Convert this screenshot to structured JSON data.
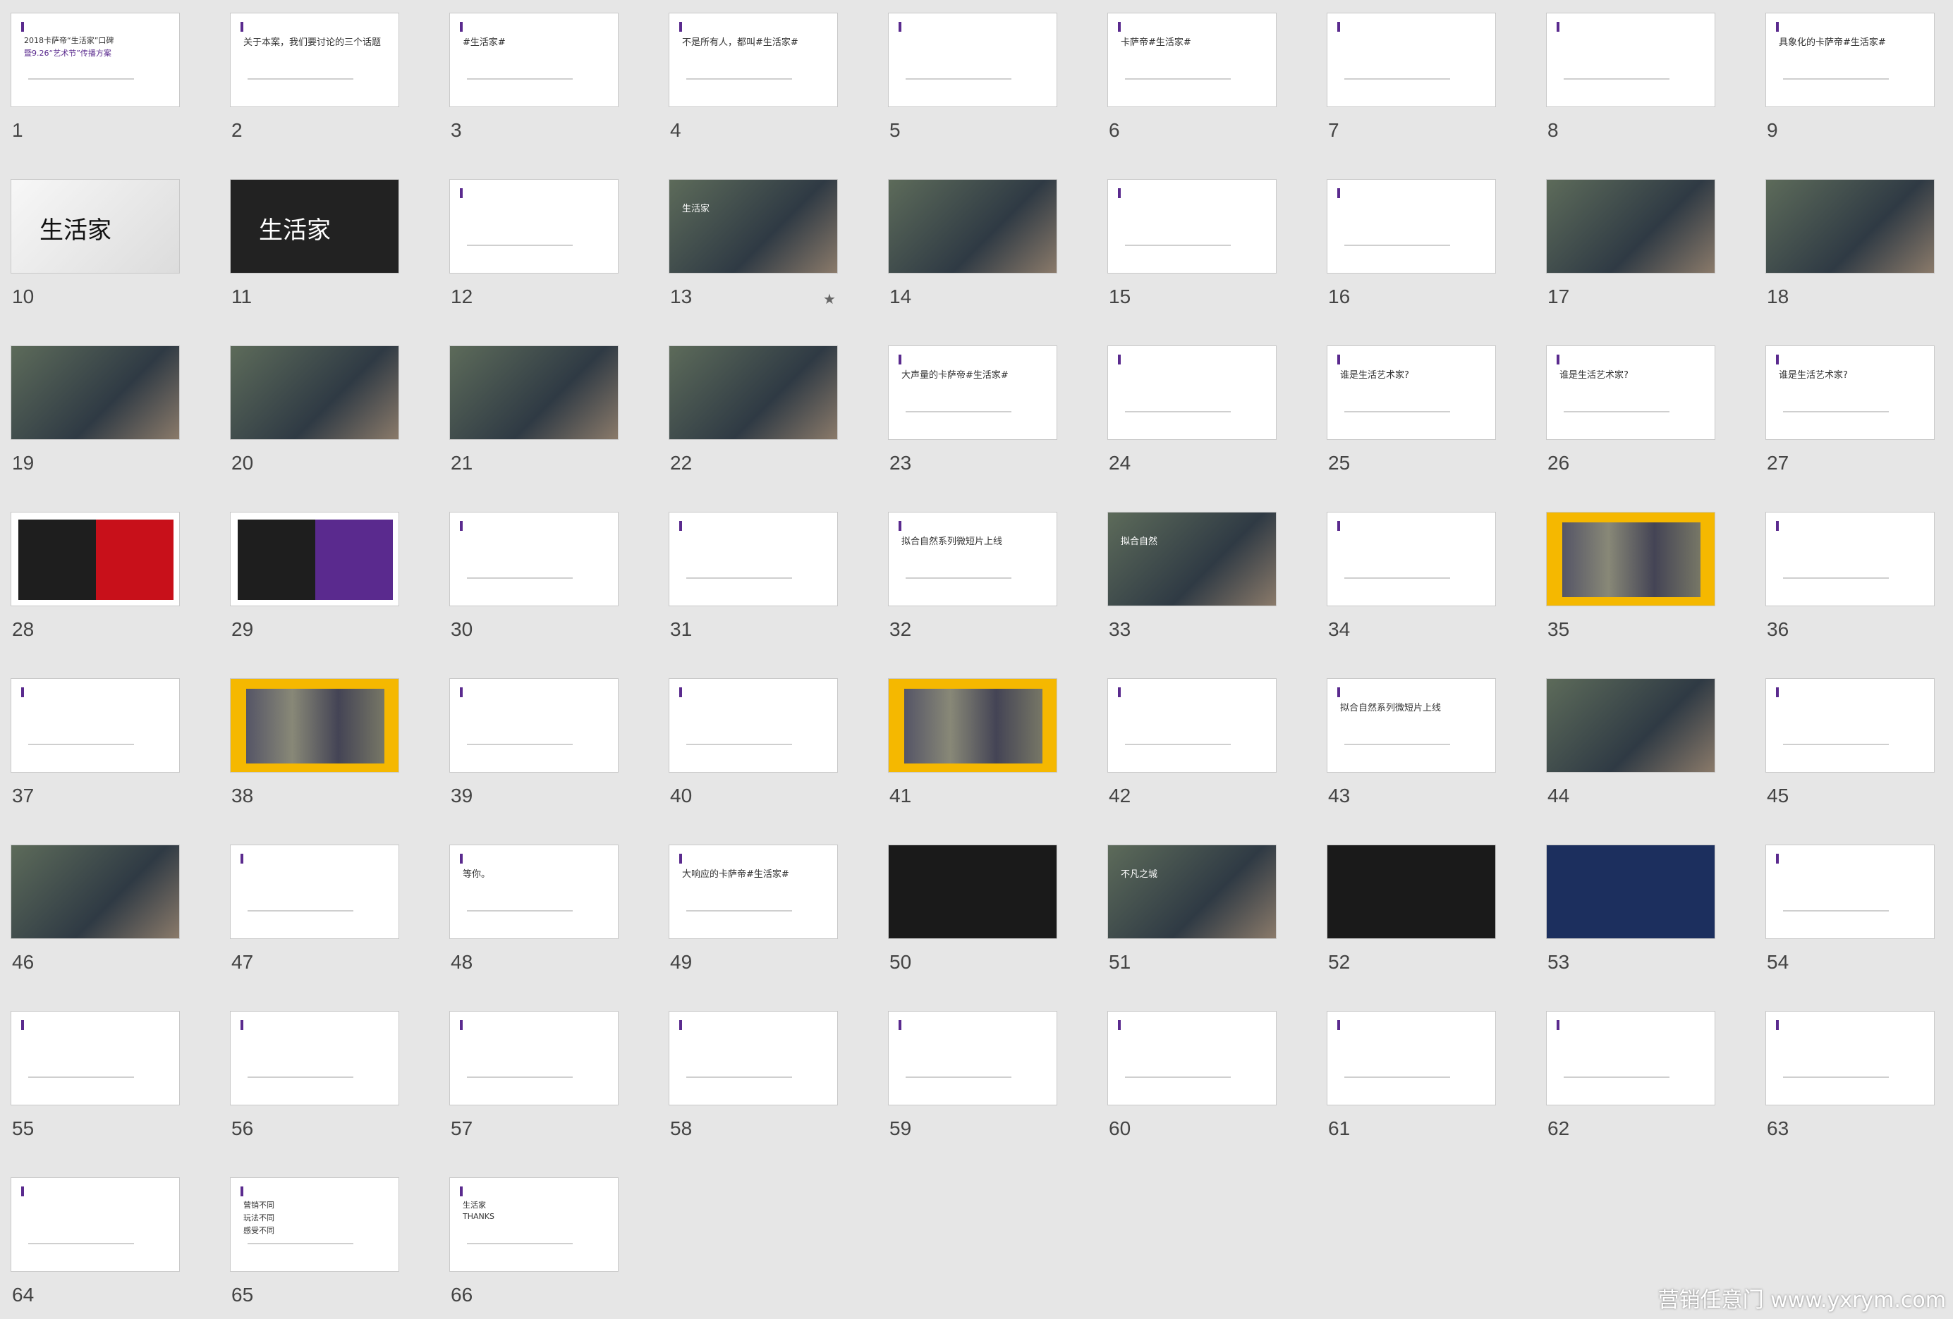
{
  "app": {
    "view": "slide sorter",
    "watermark": "营销任意门 www.yxrym.com"
  },
  "accent": "#5a2a8e",
  "slides": [
    {
      "num": "1",
      "theme": "white",
      "lines": [
        "2018卡萨帝“生活家”口碑",
        "暨9.26“艺术节”传播方案"
      ]
    },
    {
      "num": "2",
      "theme": "white",
      "lines": [
        "关于本案，我们要讨论的三个话题"
      ]
    },
    {
      "num": "3",
      "theme": "white",
      "lines": [
        "#生活家#"
      ]
    },
    {
      "num": "4",
      "theme": "white",
      "lines": [
        "不是所有人，都叫#生活家#"
      ]
    },
    {
      "num": "5",
      "theme": "white",
      "lines": []
    },
    {
      "num": "6",
      "theme": "white",
      "lines": [
        "卡萨帝#生活家#"
      ]
    },
    {
      "num": "7",
      "theme": "white",
      "lines": []
    },
    {
      "num": "8",
      "theme": "white",
      "lines": []
    },
    {
      "num": "9",
      "theme": "white",
      "lines": [
        "具象化的卡萨帝#生活家#"
      ]
    },
    {
      "num": "10",
      "theme": "lightlogo",
      "lines": [
        "生活家"
      ]
    },
    {
      "num": "11",
      "theme": "darklogo",
      "lines": [
        "生活家"
      ]
    },
    {
      "num": "12",
      "theme": "white",
      "lines": []
    },
    {
      "num": "13",
      "theme": "photo",
      "lines": [
        "生活家"
      ]
    },
    {
      "num": "14",
      "theme": "photo",
      "lines": []
    },
    {
      "num": "15",
      "theme": "white",
      "lines": []
    },
    {
      "num": "16",
      "theme": "white",
      "lines": []
    },
    {
      "num": "17",
      "theme": "photo",
      "lines": []
    },
    {
      "num": "18",
      "theme": "photo",
      "lines": []
    },
    {
      "num": "19",
      "theme": "photo",
      "lines": []
    },
    {
      "num": "20",
      "theme": "photo",
      "lines": []
    },
    {
      "num": "21",
      "theme": "photo",
      "lines": []
    },
    {
      "num": "22",
      "theme": "photo",
      "lines": []
    },
    {
      "num": "23",
      "theme": "white",
      "lines": [
        "大声量的卡萨帝#生活家#"
      ]
    },
    {
      "num": "24",
      "theme": "white",
      "lines": []
    },
    {
      "num": "25",
      "theme": "white",
      "lines": [
        "谁是生活艺术家?"
      ]
    },
    {
      "num": "26",
      "theme": "white",
      "lines": [
        "谁是生活艺术家?"
      ]
    },
    {
      "num": "27",
      "theme": "white",
      "lines": [
        "谁是生活艺术家?"
      ]
    },
    {
      "num": "28",
      "theme": "redblack",
      "lines": []
    },
    {
      "num": "29",
      "theme": "purpleblack",
      "lines": []
    },
    {
      "num": "30",
      "theme": "white",
      "lines": []
    },
    {
      "num": "31",
      "theme": "white",
      "lines": []
    },
    {
      "num": "32",
      "theme": "white",
      "lines": [
        "拟合自然系列微短片上线"
      ]
    },
    {
      "num": "33",
      "theme": "photo",
      "lines": [
        "拟合自然"
      ]
    },
    {
      "num": "34",
      "theme": "white",
      "lines": []
    },
    {
      "num": "35",
      "theme": "yellow",
      "lines": []
    },
    {
      "num": "36",
      "theme": "white",
      "lines": []
    },
    {
      "num": "37",
      "theme": "white",
      "lines": []
    },
    {
      "num": "38",
      "theme": "yellow",
      "lines": []
    },
    {
      "num": "39",
      "theme": "white",
      "lines": []
    },
    {
      "num": "40",
      "theme": "white",
      "lines": []
    },
    {
      "num": "41",
      "theme": "yellow",
      "lines": []
    },
    {
      "num": "42",
      "theme": "white",
      "lines": []
    },
    {
      "num": "43",
      "theme": "white",
      "lines": [
        "拟合自然系列微短片上线"
      ]
    },
    {
      "num": "44",
      "theme": "photo",
      "lines": []
    },
    {
      "num": "45",
      "theme": "white",
      "lines": []
    },
    {
      "num": "46",
      "theme": "photo",
      "lines": []
    },
    {
      "num": "47",
      "theme": "white",
      "lines": []
    },
    {
      "num": "48",
      "theme": "white",
      "lines": [
        "等你。"
      ]
    },
    {
      "num": "49",
      "theme": "white",
      "lines": [
        "大响应的卡萨帝#生活家#"
      ]
    },
    {
      "num": "50",
      "theme": "dark",
      "lines": []
    },
    {
      "num": "51",
      "theme": "photo",
      "lines": [
        "不凡之城"
      ]
    },
    {
      "num": "52",
      "theme": "dark",
      "lines": []
    },
    {
      "num": "53",
      "theme": "blue",
      "lines": []
    },
    {
      "num": "54",
      "theme": "white",
      "lines": []
    },
    {
      "num": "55",
      "theme": "white",
      "lines": []
    },
    {
      "num": "56",
      "theme": "white",
      "lines": []
    },
    {
      "num": "57",
      "theme": "white",
      "lines": []
    },
    {
      "num": "58",
      "theme": "white",
      "lines": []
    },
    {
      "num": "59",
      "theme": "white",
      "lines": []
    },
    {
      "num": "60",
      "theme": "white",
      "lines": []
    },
    {
      "num": "61",
      "theme": "white",
      "lines": []
    },
    {
      "num": "62",
      "theme": "white",
      "lines": []
    },
    {
      "num": "63",
      "theme": "white",
      "lines": []
    },
    {
      "num": "64",
      "theme": "white",
      "lines": []
    },
    {
      "num": "65",
      "theme": "white",
      "lines": [
        "营销不同",
        "玩法不同",
        "感受不同"
      ]
    },
    {
      "num": "66",
      "theme": "white",
      "lines": [
        "生活家",
        "THANKS"
      ]
    }
  ]
}
